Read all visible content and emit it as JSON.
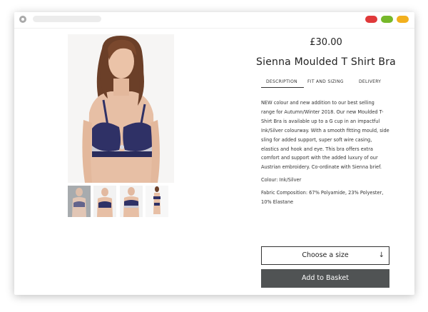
{
  "window": {
    "controls": [
      {
        "name": "close",
        "color": "#e0393a"
      },
      {
        "name": "minimize",
        "color": "#76b82a"
      },
      {
        "name": "maximize",
        "color": "#f2b01e"
      }
    ]
  },
  "product": {
    "price": "£30.00",
    "title": "Sienna Moulded T Shirt Bra",
    "tabs": [
      "DESCRIPTION",
      "FIT AND SIZING",
      "DELIVERY"
    ],
    "active_tab": "DESCRIPTION",
    "description": "NEW colour and new addition to our best selling range for Autumn/Winter 2018. Our new Moulded T-Shirt Bra is available up to a G cup in an impactful Ink/Silver colourway. With a smooth fitting mould, side sling for added support, super soft wire casing, elastics and hook and eye. This bra offers extra comfort and support with the added luxury of our Austrian embroidery. Co-ordinate with Sienna brief.",
    "colour": "Colour: Ink/Silver",
    "composition": "Fabric Composition: 67% Polyamide, 23% Polyester, 10% Elastane",
    "size_placeholder": "Choose a size",
    "size_arrow": "↓",
    "basket_label": "Add to Basket"
  },
  "colors": {
    "bra_navy": "#2f3166",
    "basket_button": "#505354"
  }
}
